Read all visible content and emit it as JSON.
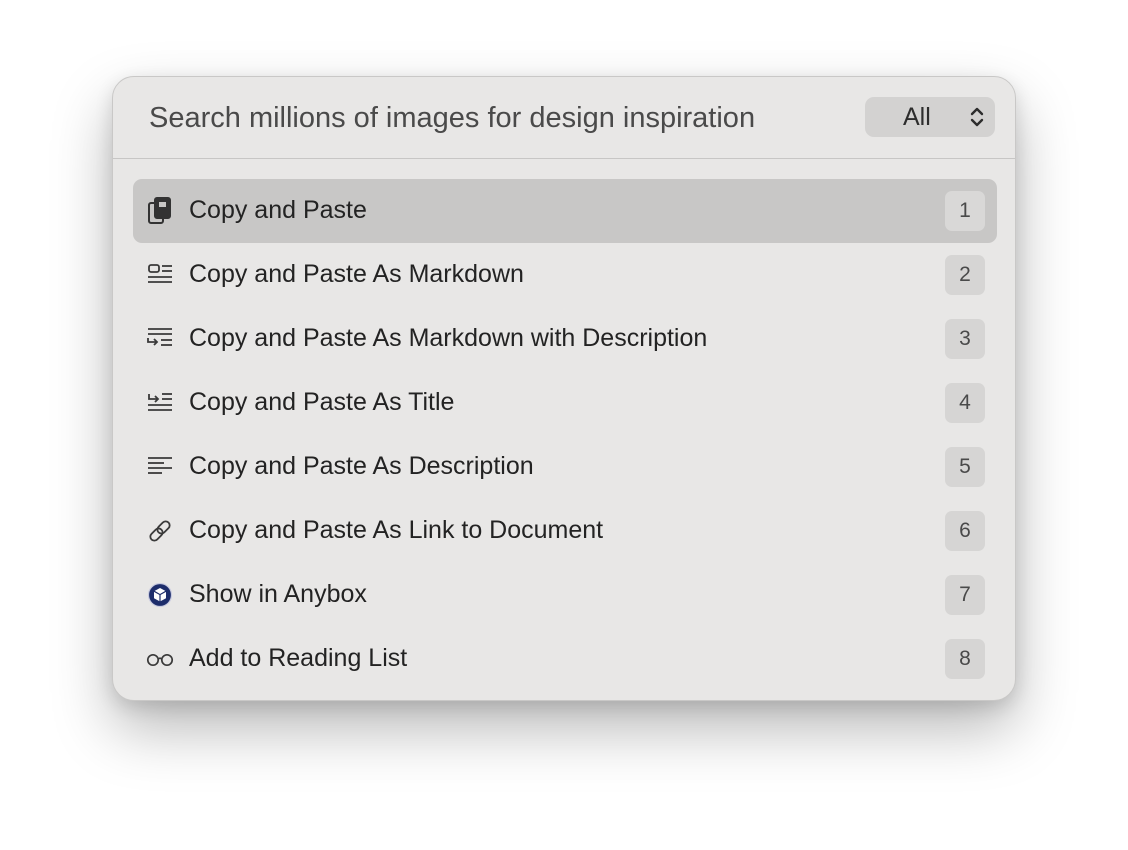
{
  "search": {
    "placeholder": "Search millions of images for design inspiration"
  },
  "filter": {
    "selected": "All",
    "icon": "chevron-up-down-icon"
  },
  "actions": [
    {
      "label": "Copy and Paste",
      "shortcut": "1",
      "icon": "copy-paste-icon",
      "selected": true
    },
    {
      "label": "Copy and Paste As Markdown",
      "shortcut": "2",
      "icon": "markdown-icon",
      "selected": false
    },
    {
      "label": "Copy and Paste As Markdown with Description",
      "shortcut": "3",
      "icon": "markdown-description-icon",
      "selected": false
    },
    {
      "label": "Copy and Paste As Title",
      "shortcut": "4",
      "icon": "title-icon",
      "selected": false
    },
    {
      "label": "Copy and Paste As Description",
      "shortcut": "5",
      "icon": "description-icon",
      "selected": false
    },
    {
      "label": "Copy and Paste As Link to Document",
      "shortcut": "6",
      "icon": "link-icon",
      "selected": false
    },
    {
      "label": "Show in Anybox",
      "shortcut": "7",
      "icon": "anybox-app-icon",
      "selected": false
    },
    {
      "label": "Add to Reading List",
      "shortcut": "8",
      "icon": "glasses-icon",
      "selected": false
    }
  ],
  "colors": {
    "panel_background": "#e8e7e6",
    "selected_row": "#c8c7c6",
    "anybox_brand": "#1d2d6b"
  }
}
